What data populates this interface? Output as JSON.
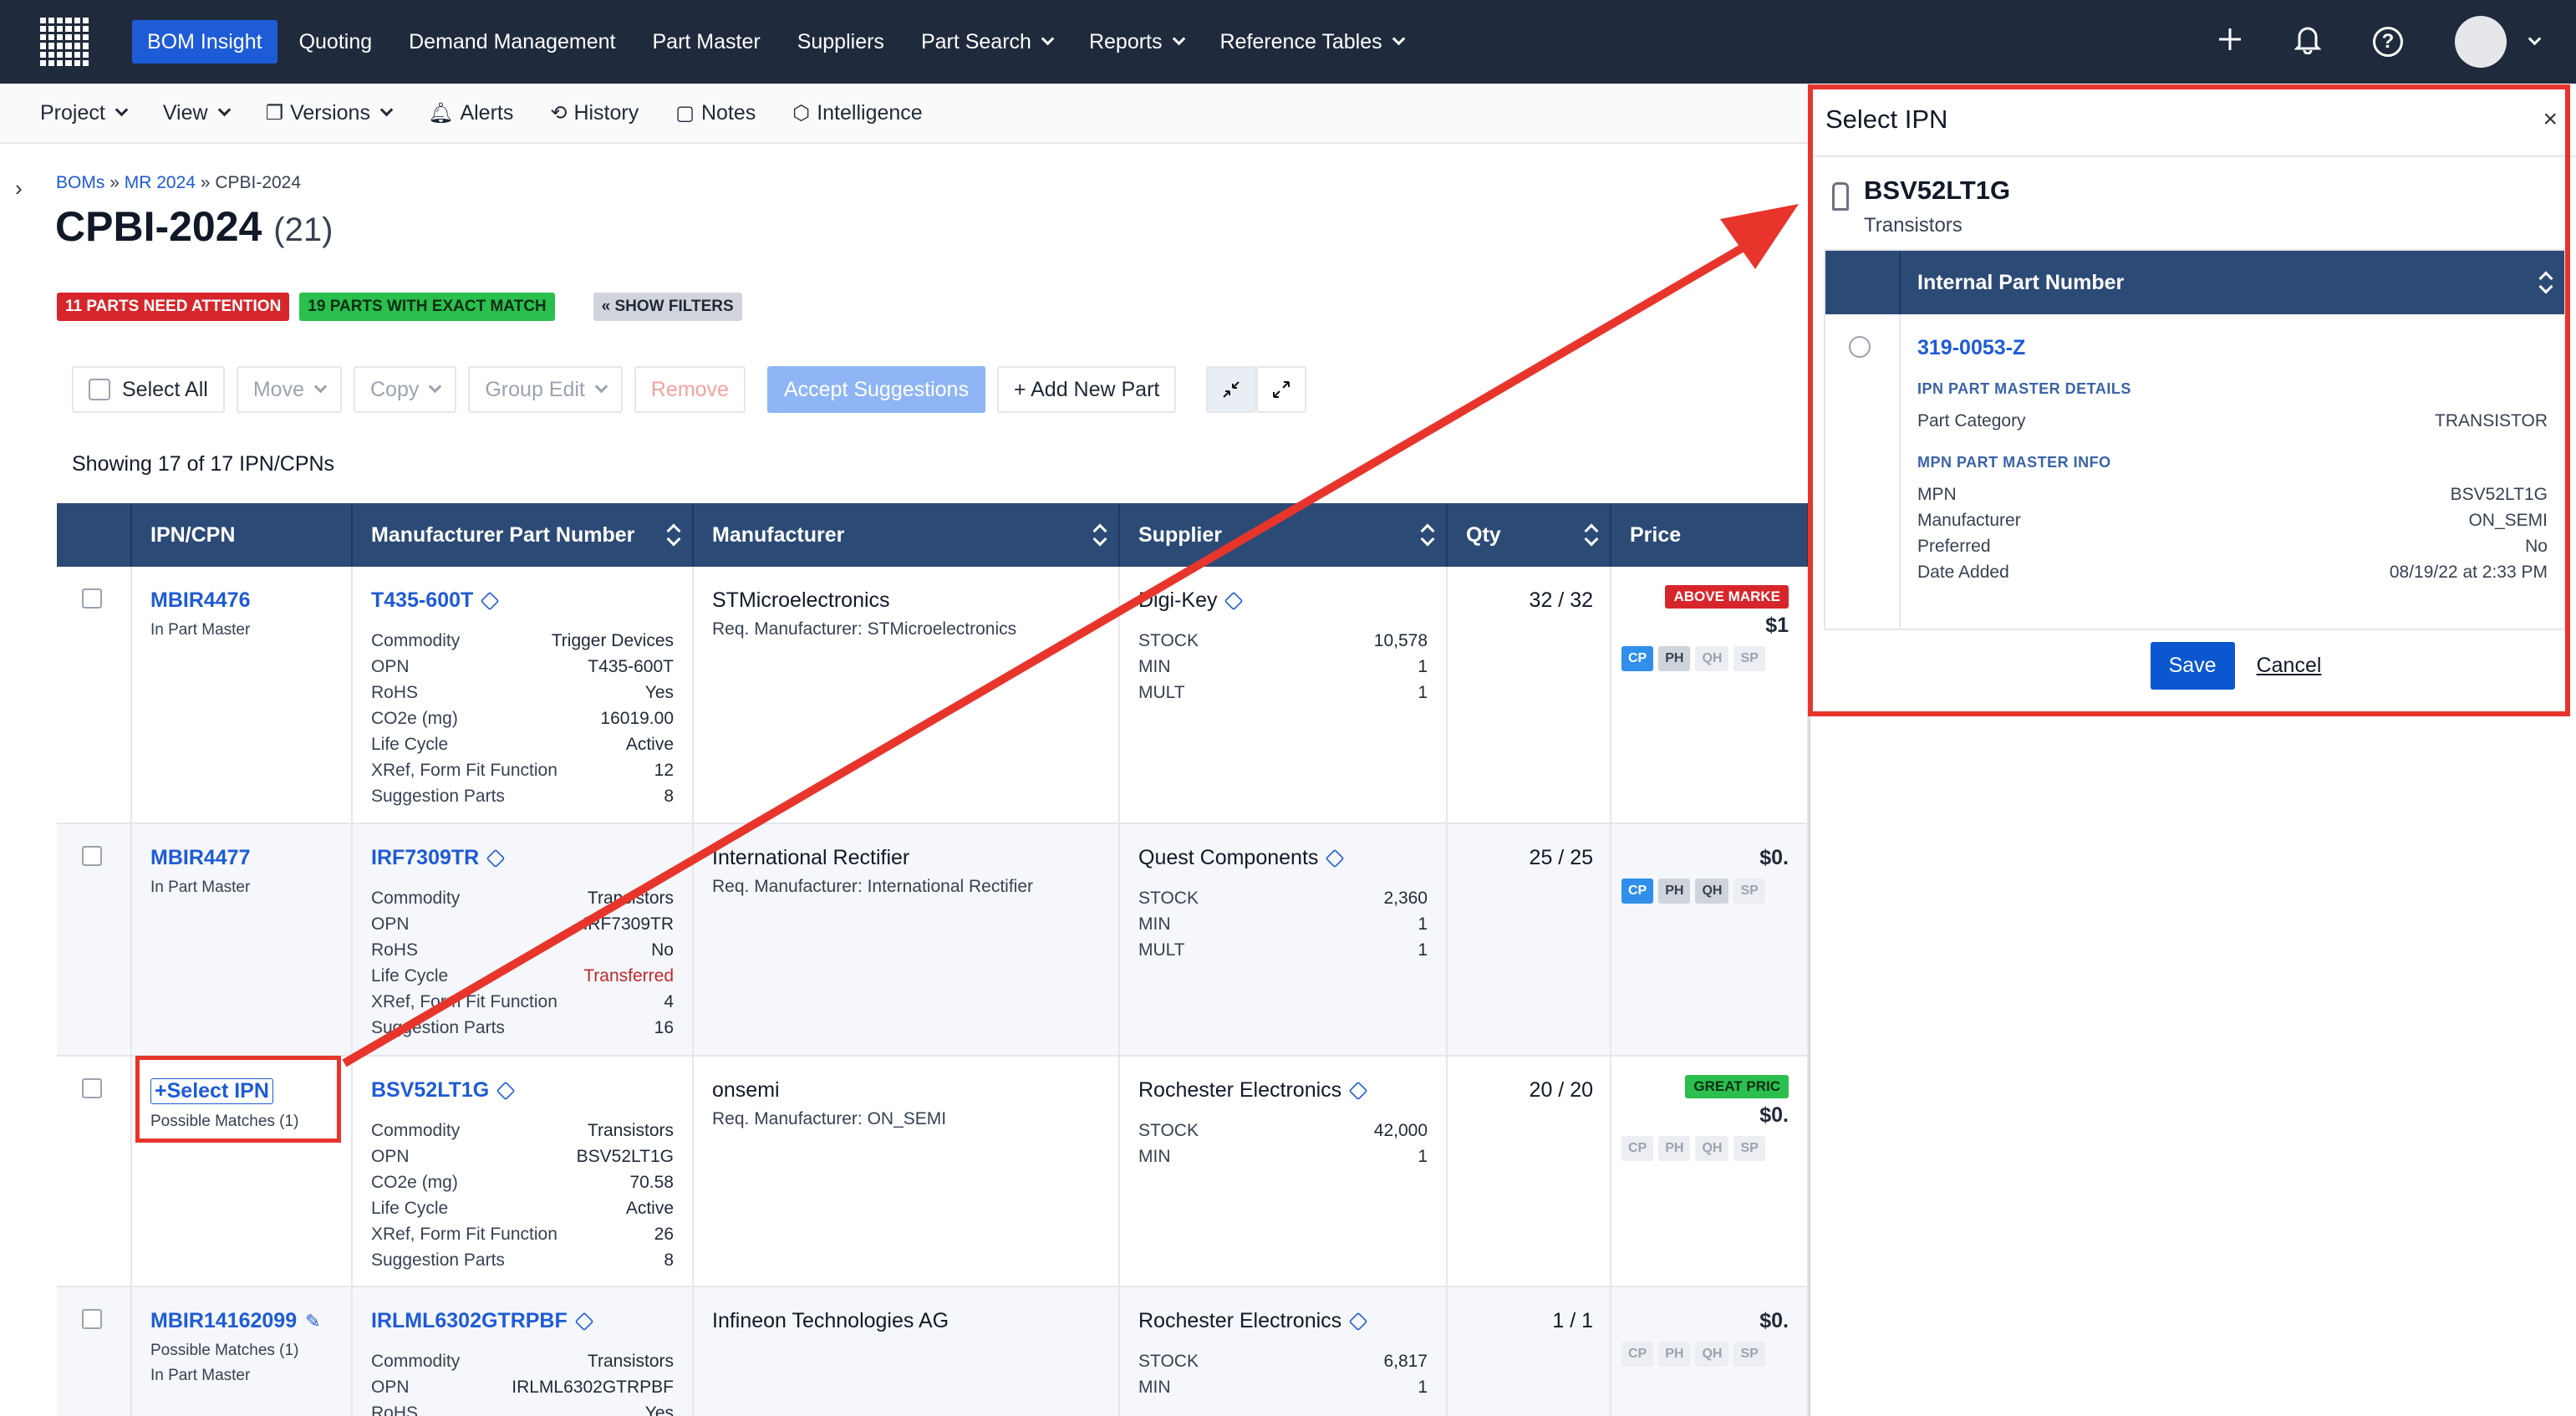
{
  "topnav": {
    "items": [
      "BOM Insight",
      "Quoting",
      "Demand Management",
      "Part Master",
      "Suppliers",
      "Part Search",
      "Reports",
      "Reference Tables"
    ],
    "active": "BOM Insight",
    "brand_color": "#1e5bd6"
  },
  "subnav": {
    "project": "Project",
    "view": "View",
    "versions": "Versions",
    "alerts": "Alerts",
    "history": "History",
    "notes": "Notes",
    "intelligence": "Intelligence"
  },
  "breadcrumb": {
    "boms": "BOMs",
    "sep": "»",
    "mr": "MR 2024",
    "current": "CPBI-2024"
  },
  "page": {
    "title": "CPBI-2024",
    "count": "(21)"
  },
  "badges": {
    "attention": "11 PARTS NEED ATTENTION",
    "exact": "19 PARTS WITH EXACT MATCH",
    "filters": "« SHOW FILTERS"
  },
  "toolbar": {
    "select_all": "Select All",
    "move": "Move",
    "copy": "Copy",
    "group_edit": "Group Edit",
    "remove": "Remove",
    "accept": "Accept Suggestions",
    "add_new": "+ Add New Part"
  },
  "showing": "Showing 17 of 17 IPN/CPNs",
  "table": {
    "headers": {
      "ipn": "IPN/CPN",
      "mpn": "Manufacturer Part Number",
      "mfr": "Manufacturer",
      "supplier": "Supplier",
      "qty": "Qty",
      "price": "Price"
    },
    "rows": [
      {
        "ipn": "MBIR4476",
        "ipn_sub": "In Part Master",
        "mpn": "T435-600T",
        "attrs": [
          [
            "Commodity",
            "Trigger Devices"
          ],
          [
            "OPN",
            "T435-600T"
          ],
          [
            "RoHS",
            "Yes"
          ],
          [
            "CO2e (mg)",
            "16019.00"
          ],
          [
            "Life Cycle",
            "Active"
          ],
          [
            "XRef, Form Fit Function",
            "12"
          ],
          [
            "Suggestion Parts",
            "8"
          ]
        ],
        "mfr": "STMicroelectronics",
        "mfr_req": "Req. Manufacturer: STMicroelectronics",
        "supplier": "Digi-Key",
        "sup_attrs": [
          [
            "STOCK",
            "10,578"
          ],
          [
            "MIN",
            "1"
          ],
          [
            "MULT",
            "1"
          ]
        ],
        "qty": "32 / 32",
        "price_badge": "ABOVE MARKE",
        "price": "$1",
        "chips": [
          "CP",
          "PH",
          "QH",
          "SP"
        ]
      },
      {
        "ipn": "MBIR4477",
        "ipn_sub": "In Part Master",
        "mpn": "IRF7309TR",
        "attrs": [
          [
            "Commodity",
            "Transistors"
          ],
          [
            "OPN",
            "IRF7309TR"
          ],
          [
            "RoHS",
            "No"
          ],
          [
            "Life Cycle",
            "Transferred"
          ],
          [
            "XRef, Form Fit Function",
            "4"
          ],
          [
            "Suggestion Parts",
            "16"
          ]
        ],
        "mfr": "International Rectifier",
        "mfr_req": "Req. Manufacturer: International Rectifier",
        "supplier": "Quest Components",
        "sup_attrs": [
          [
            "STOCK",
            "2,360"
          ],
          [
            "MIN",
            "1"
          ],
          [
            "MULT",
            "1"
          ]
        ],
        "qty": "25 / 25",
        "price": "$0.",
        "chips": [
          "CP",
          "PH",
          "QH",
          "SP"
        ]
      },
      {
        "ipn_action": "Select IPN",
        "ipn_sub": "Possible Matches (1)",
        "mpn": "BSV52LT1G",
        "attrs": [
          [
            "Commodity",
            "Transistors"
          ],
          [
            "OPN",
            "BSV52LT1G"
          ],
          [
            "CO2e (mg)",
            "70.58"
          ],
          [
            "Life Cycle",
            "Active"
          ],
          [
            "XRef, Form Fit Function",
            "26"
          ],
          [
            "Suggestion Parts",
            "8"
          ]
        ],
        "mfr": "onsemi",
        "mfr_req": "Req. Manufacturer: ON_SEMI",
        "supplier": "Rochester Electronics",
        "sup_attrs": [
          [
            "STOCK",
            "42,000"
          ],
          [
            "MIN",
            "1"
          ]
        ],
        "qty": "20 / 20",
        "price_badge": "GREAT PRIC",
        "price": "$0.",
        "chips": [
          "CP",
          "PH",
          "QH",
          "SP"
        ]
      },
      {
        "ipn": "MBIR14162099",
        "ipn_sub": "Possible Matches (1)",
        "ipn_sub2": "In Part Master",
        "mpn": "IRLML6302GTRPBF",
        "attrs": [
          [
            "Commodity",
            "Transistors"
          ],
          [
            "OPN",
            "IRLML6302GTRPBF"
          ],
          [
            "RoHS",
            "Yes"
          ]
        ],
        "mfr": "Infineon Technologies AG",
        "supplier": "Rochester Electronics",
        "sup_attrs": [
          [
            "STOCK",
            "6,817"
          ],
          [
            "MIN",
            "1"
          ]
        ],
        "qty": "1 / 1",
        "price": "$0.",
        "chips": [
          "CP",
          "PH",
          "QH",
          "SP"
        ]
      }
    ]
  },
  "panel": {
    "title": "Select IPN",
    "close": "×",
    "mpn": "BSV52LT1G",
    "category": "Transistors",
    "col_header": "Internal Part Number",
    "ipn": "319-0053-Z",
    "details_title": "IPN PART MASTER DETAILS",
    "part_category_label": "Part Category",
    "part_category": "TRANSISTOR",
    "master_title": "MPN PART MASTER INFO",
    "mpn_label": "MPN",
    "mpn_value": "BSV52LT1G",
    "manufacturer_label": "Manufacturer",
    "manufacturer_value": "ON_SEMI",
    "preferred_label": "Preferred",
    "preferred_value": "No",
    "date_label": "Date Added",
    "date_value": "08/19/22 at 2:33 PM",
    "save": "Save",
    "cancel": "Cancel"
  },
  "icons": {
    "add": "plus-icon",
    "alerts": "bell-icon",
    "help": "question-icon",
    "collapse": "collapse-icon",
    "expand": "expand-icon"
  },
  "colors": {
    "nav_bg": "#1f2a3c",
    "table_header": "#2c4a76",
    "annotation_red": "#e8352c"
  }
}
